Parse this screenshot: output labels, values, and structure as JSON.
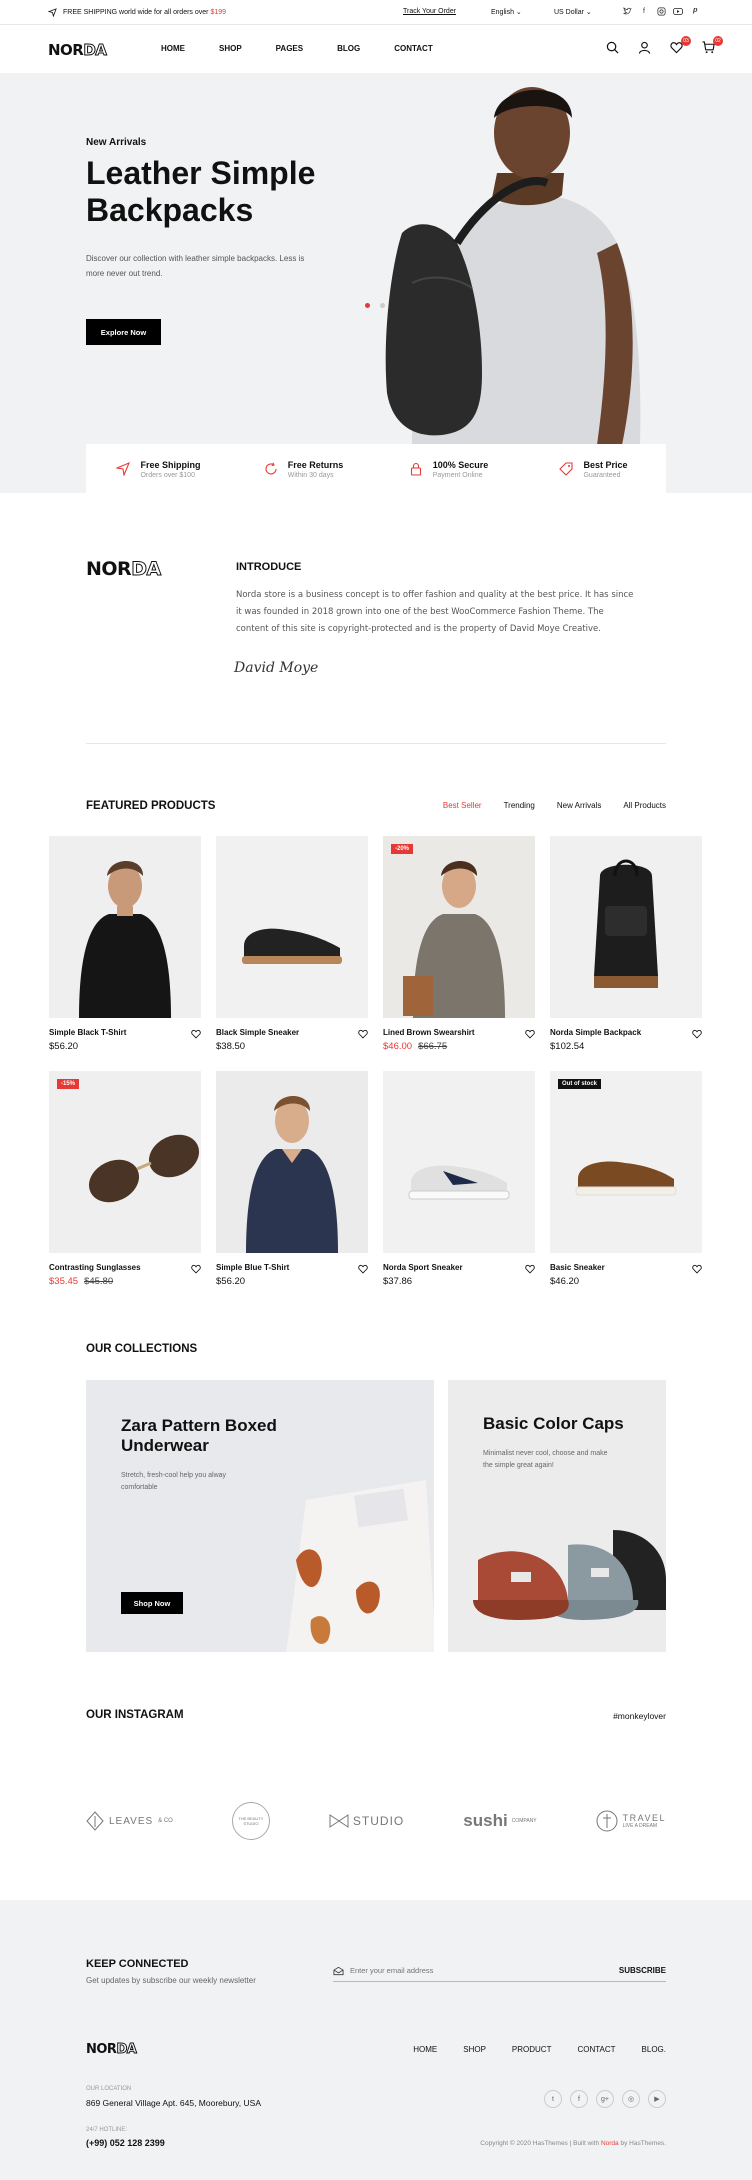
{
  "topbar": {
    "shipping_text": "FREE SHIPPING world wide for all orders over",
    "shipping_amount": "$199",
    "track_order": "Track Your Order",
    "language": "English",
    "currency": "US Dollar",
    "social_icons": [
      "twitter-icon",
      "facebook-icon",
      "instagram-icon",
      "youtube-icon",
      "pinterest-icon"
    ]
  },
  "header": {
    "logo_a": "NOR",
    "logo_b": "DA",
    "nav": [
      "HOME",
      "SHOP",
      "PAGES",
      "BLOG",
      "CONTACT"
    ],
    "wishlist_count": "03",
    "cart_count": "02"
  },
  "hero": {
    "eyebrow": "New Arrivals",
    "title": "Leather Simple Backpacks",
    "description": "Discover our collection with leather simple backpacks. Less is more never out trend.",
    "button": "Explore Now",
    "active_slide": 1,
    "slide_count": 2
  },
  "features": [
    {
      "icon": "paper-plane-icon",
      "title": "Free Shipping",
      "subtitle": "Orders over $100"
    },
    {
      "icon": "refresh-icon",
      "title": "Free Returns",
      "subtitle": "Within 30 days"
    },
    {
      "icon": "lock-icon",
      "title": "100% Secure",
      "subtitle": "Payment Online"
    },
    {
      "icon": "tag-icon",
      "title": "Best Price",
      "subtitle": "Guaranteed"
    }
  ],
  "intro": {
    "title": "INTRODUCE",
    "text": "Norda store is a business concept is to offer fashion and quality at the best price. It has since it was founded in 2018 grown into one of the best WooCommerce Fashion Theme. The content of this site is copyright-protected and is the property of David Moye Creative.",
    "signature": "David Moye"
  },
  "featured": {
    "title": "FEATURED PRODUCTS",
    "tabs": [
      "Best Seller",
      "Trending",
      "New Arrivals",
      "All Products"
    ],
    "products": [
      {
        "name": "Simple Black T-Shirt",
        "price": "$56.20",
        "old_price": "",
        "tag": "",
        "image": "model-black-tshirt"
      },
      {
        "name": "Black Simple Sneaker",
        "price": "$38.50",
        "old_price": "",
        "tag": "",
        "image": "black-sneaker"
      },
      {
        "name": "Lined Brown Swearshirt",
        "price": "$46.00",
        "old_price": "$66.75",
        "tag": "-20%",
        "image": "model-brown-sweater"
      },
      {
        "name": "Norda Simple Backpack",
        "price": "$102.54",
        "old_price": "",
        "tag": "",
        "image": "black-backpack"
      },
      {
        "name": "Contrasting Sunglasses",
        "price": "$35.45",
        "old_price": "$45.80",
        "tag": "-15%",
        "image": "sunglasses"
      },
      {
        "name": "Simple Blue T-Shirt",
        "price": "$56.20",
        "old_price": "",
        "tag": "",
        "image": "model-blue-tshirt"
      },
      {
        "name": "Norda Sport Sneaker",
        "price": "$37.86",
        "old_price": "",
        "tag": "",
        "image": "sport-sneaker"
      },
      {
        "name": "Basic Sneaker",
        "price": "$46.20",
        "old_price": "",
        "tag": "Out of stock",
        "image": "brown-sneaker"
      }
    ]
  },
  "collections": {
    "title": "OUR COLLECTIONS",
    "items": [
      {
        "title": "Zara Pattern Boxed Underwear",
        "text": "Stretch, fresh-cool help you alway comfortable",
        "button": "Shop Now"
      },
      {
        "title": "Basic Color Caps",
        "text": "Minimalist never cool, choose and make the simple great again!"
      }
    ]
  },
  "instagram": {
    "title": "OUR INSTAGRAM",
    "hashtag": "#monkeylover",
    "brands": [
      {
        "name": "LEAVES",
        "suffix": "& CO"
      },
      {
        "name": "THE BEAUTY STUDIO"
      },
      {
        "name": "STUDIO"
      },
      {
        "name": "sushi",
        "suffix": "COMPANY"
      },
      {
        "name": "TRAVEL",
        "suffix": "LIVE A DREAM"
      }
    ]
  },
  "footer": {
    "newsletter_title": "KEEP CONNECTED",
    "newsletter_text": "Get updates by subscribe our weekly newsletter",
    "email_placeholder": "Enter your email address",
    "subscribe": "SUBSCRIBE",
    "nav": [
      "HOME",
      "SHOP",
      "PRODUCT",
      "CONTACT",
      "BLOG."
    ],
    "location_label": "OUR LOCATION",
    "address": "869 General Village Apt. 645, Moorebury, USA",
    "hotline_label": "24/7 HOTLINE:",
    "phone": "(+99) 052 128 2399",
    "copyright_a": "Copyright © 2020 HasThemes | Built with",
    "copyright_brand": "Norda",
    "copyright_b": "by HasThemes.",
    "social_icons": [
      "twitter-icon",
      "facebook-icon",
      "google-plus-icon",
      "instagram-icon",
      "youtube-icon"
    ]
  },
  "colors": {
    "accent": "#e53935",
    "hero_bg": "#f1f2f4",
    "dark": "#000000"
  }
}
